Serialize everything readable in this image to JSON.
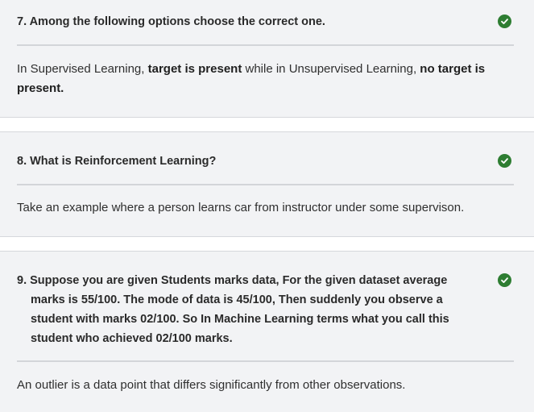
{
  "questions": [
    {
      "question": "7. Among the following options choose the correct one.",
      "answer_parts": [
        {
          "text": "In Supervised Learning, ",
          "bold": false
        },
        {
          "text": "target is present",
          "bold": true
        },
        {
          "text": " while in Unsupervised Learning, ",
          "bold": false
        },
        {
          "text": "no target is present.",
          "bold": true
        }
      ],
      "status_icon": "check-circle-icon"
    },
    {
      "question": "8. What is Reinforcement Learning?",
      "answer": "Take an example where a person learns car from instructor under some supervison.",
      "status_icon": "check-circle-icon"
    },
    {
      "question": "9. Suppose you are given Students marks data, For the given dataset average marks is 55/100. The mode of data is 45/100, Then suddenly you observe a student with marks 02/100. So In Machine Learning terms what you call this student who achieved 02/100 marks.",
      "answer": "An outlier is a data point that differs significantly from other observations.",
      "status_icon": "check-circle-icon"
    }
  ],
  "colors": {
    "card_bg": "#f2f3f5",
    "gap_bg": "#ffffff",
    "check": "#2e7d32",
    "divider": "#d3d5d9"
  }
}
